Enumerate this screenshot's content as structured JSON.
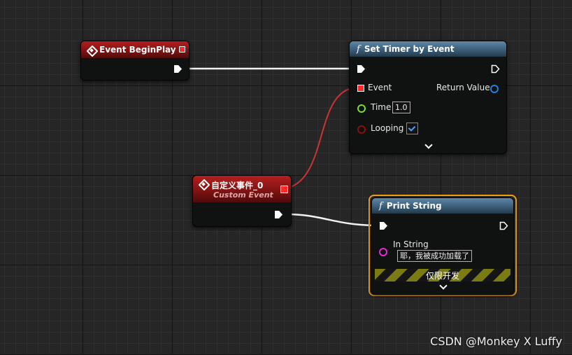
{
  "nodes": {
    "begin_play": {
      "title": "Event BeginPlay"
    },
    "set_timer": {
      "title": "Set Timer by Event",
      "pins": {
        "event": "Event",
        "return_value": "Return Value",
        "time": "Time",
        "time_value": "1.0",
        "looping": "Looping"
      }
    },
    "custom_event": {
      "title": "自定义事件_0",
      "subtitle": "Custom Event"
    },
    "print_string": {
      "title": "Print String",
      "pins": {
        "in_string": "In String",
        "in_string_value": "耶，我被成功加载了"
      },
      "dev_only": "仅限开发"
    }
  },
  "watermark": "CSDN @Monkey X Luffy",
  "colors": {
    "event_header": "#9b1a1a",
    "function_header": "#4a7190",
    "delegate_pin": "#ff2b2b",
    "float_pin": "#7cde2a",
    "bool_pin": "#8a1010",
    "string_pin": "#e22dd0",
    "struct_pin": "#2a7cdf",
    "selection": "#f2a21a"
  }
}
